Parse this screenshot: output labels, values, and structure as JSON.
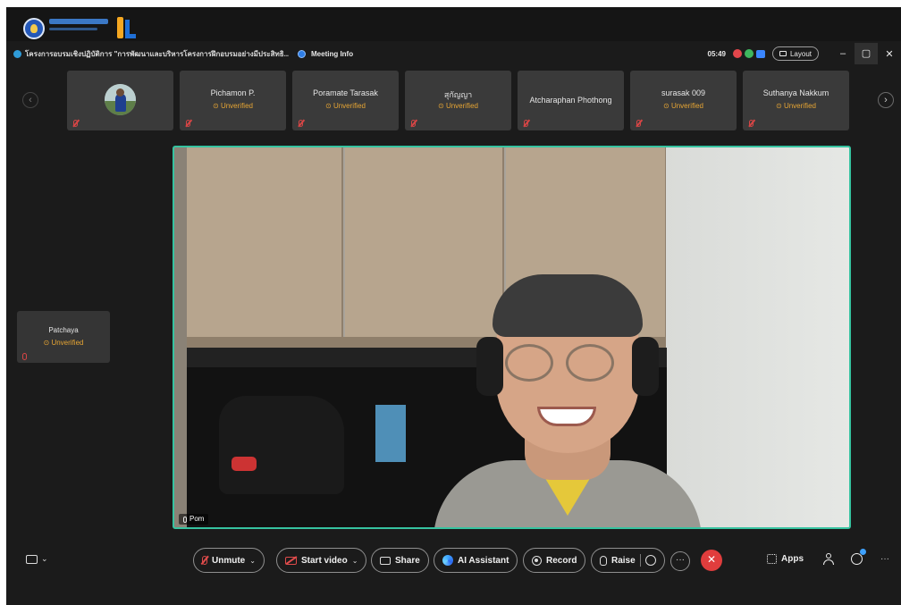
{
  "title_bar": {
    "meeting_title": "โครงการอบรมเชิงปฏิบัติการ \"การพัฒนาและบริหารโครงการฝึกอบรมอย่างมีประสิทธิ...",
    "meeting_info": "Meeting Info",
    "timer": "05:49",
    "layout_label": "Layout",
    "minimize": "–",
    "restore": "▢",
    "close": "✕"
  },
  "participants_strip": {
    "prev_icon": "‹",
    "next_icon": "›",
    "tiles": [
      {
        "name": "",
        "status": "",
        "has_avatar": true
      },
      {
        "name": "Pichamon P.",
        "status": "Unverified"
      },
      {
        "name": "Poramate Tarasak",
        "status": "Unverified"
      },
      {
        "name": "สุกัญญา",
        "status": "Unverified"
      },
      {
        "name": "Atcharaphan Phothong",
        "status": ""
      },
      {
        "name": "surasak 009",
        "status": "Unverified"
      },
      {
        "name": "Suthanya Nakkum",
        "status": "Unverified"
      }
    ]
  },
  "side_tile": {
    "name": "Patchaya",
    "status": "Unverified"
  },
  "active_speaker": {
    "name": "Pom",
    "border_color": "#36c3a0"
  },
  "toolbar": {
    "chat_caret": "⌄",
    "unmute": "Unmute",
    "start_video": "Start video",
    "share": "Share",
    "ai_assistant": "AI Assistant",
    "record": "Record",
    "raise": "Raise",
    "more": "···",
    "end": "✕",
    "apps": "Apps",
    "more_right": "···",
    "caret": "⌄"
  },
  "colors": {
    "unverified": "#e6a534",
    "end_call": "#e03d3d",
    "muted": "#d64545"
  }
}
